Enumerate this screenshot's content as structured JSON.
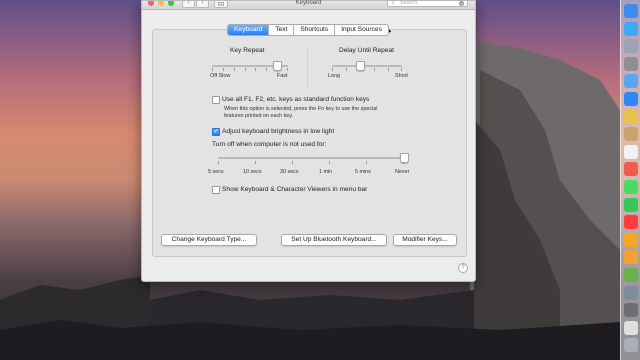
{
  "window": {
    "title": "Keyboard"
  },
  "toolbar": {
    "back_glyph": "‹",
    "forward_glyph": "›",
    "search_placeholder": "Search"
  },
  "tabs": [
    {
      "label": "Keyboard",
      "active": true
    },
    {
      "label": "Text",
      "active": false
    },
    {
      "label": "Shortcuts",
      "active": false
    },
    {
      "label": "Input Sources",
      "active": false
    }
  ],
  "key_repeat": {
    "title": "Key Repeat",
    "min_label": "Off Slow",
    "max_label": "Fast",
    "value_fraction": 0.85
  },
  "delay": {
    "title": "Delay Until Repeat",
    "min_label": "Long",
    "max_label": "Short",
    "value_fraction": 0.4
  },
  "fn_option": {
    "label": "Use all F1, F2, etc. keys as standard function keys",
    "note_line1": "When this option is selected, press the Fn key to use the special",
    "note_line2": "features printed on each key.",
    "checked": false
  },
  "brightness_option": {
    "label": "Adjust keyboard brightness in low light",
    "checked": true
  },
  "turn_off": {
    "label": "Turn off when computer is not used for:",
    "ticks": [
      "5 secs",
      "10 secs",
      "30 secs",
      "1 min",
      "5 mins",
      "Never"
    ],
    "value_fraction": 1.0
  },
  "viewer_option": {
    "label": "Show Keyboard & Character Viewers in menu bar",
    "checked": false
  },
  "buttons": {
    "change_type": "Change Keyboard Type...",
    "bluetooth": "Set Up Bluetooth Keyboard...",
    "modifier": "Modifier Keys..."
  },
  "help_glyph": "?",
  "colors": {
    "accent": "#2a7ef0",
    "window_bg": "#ececec",
    "pane_bg": "#e3e3e3"
  },
  "dock_icons": [
    "finder-icon",
    "app-store-icon",
    "launchpad-icon",
    "system-preferences-icon",
    "mail-icon",
    "safari-icon",
    "notes-icon",
    "contacts-icon",
    "calendar-icon",
    "reminders-icon",
    "messages-icon",
    "facetime-icon",
    "music-icon",
    "photos-icon",
    "ibooks-icon",
    "maps-icon",
    "preview-icon",
    "time-machine-icon",
    "textedit-icon",
    "trash-icon"
  ]
}
